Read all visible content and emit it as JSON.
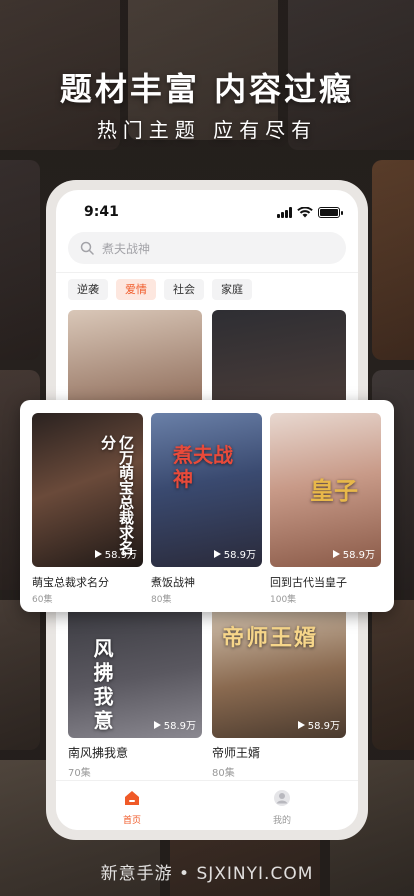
{
  "promo": {
    "headline": "题材丰富 内容过瘾",
    "subline": "热门主题 应有尽有"
  },
  "status_bar": {
    "time": "9:41"
  },
  "search": {
    "placeholder": "煮夫战神"
  },
  "tabs": [
    {
      "label": "逆袭",
      "active": false
    },
    {
      "label": "爱情",
      "active": true
    },
    {
      "label": "社会",
      "active": false
    },
    {
      "label": "家庭",
      "active": false
    }
  ],
  "featured": [
    {
      "title": "萌宝总裁求名分",
      "episodes": "60集",
      "views": "58.9万",
      "poster_text": "亿万萌宝总裁求名分"
    },
    {
      "title": "煮饭战神",
      "episodes": "80集",
      "views": "58.9万",
      "poster_text": "煮夫战神"
    },
    {
      "title": "回到古代当皇子",
      "episodes": "100集",
      "views": "58.9万",
      "poster_text": "皇子"
    }
  ],
  "grid": [
    {
      "title": "南风拂我意",
      "episodes": "70集",
      "views": "58.9万",
      "poster_text": "风拂我意"
    },
    {
      "title": "帝师王婿",
      "episodes": "80集",
      "views": "58.9万",
      "poster_text": "帝师王婿"
    }
  ],
  "tabbar": {
    "home": "首页",
    "mine": "我的"
  },
  "colors": {
    "accent": "#f05a28",
    "accent_bg": "#fde7df"
  },
  "watermark": "新意手游 • SJXINYI.COM"
}
